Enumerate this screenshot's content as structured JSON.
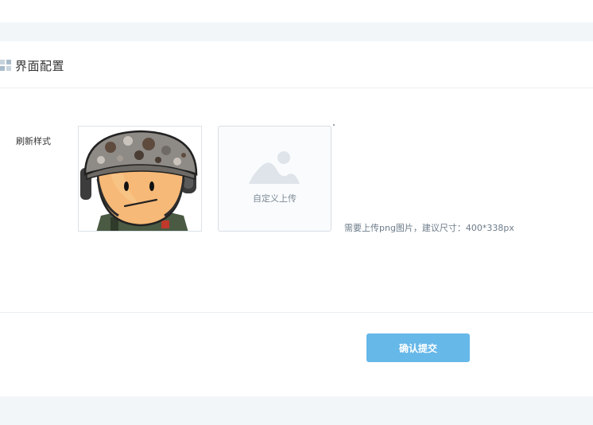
{
  "section": {
    "title": "界面配置",
    "icon": "grid-icon"
  },
  "form": {
    "field_label": "刷新样式",
    "preview": {
      "icon": "soldier-avatar-image"
    },
    "uploader": {
      "icon": "picture-icon",
      "label": "自定义上传"
    },
    "hint": "需要上传png图片，建议尺寸：400*338px"
  },
  "actions": {
    "submit_label": "确认提交"
  },
  "colors": {
    "accent": "#66b8e9",
    "band": "#f3f6f9",
    "icon": "#a9bccb"
  }
}
